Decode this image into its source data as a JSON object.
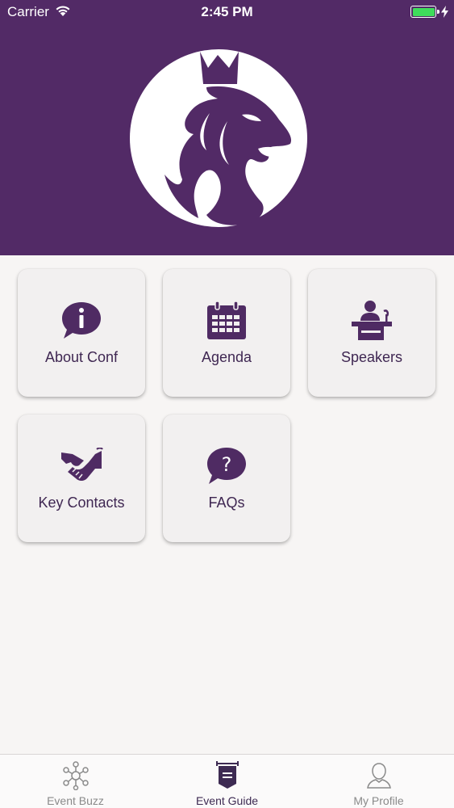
{
  "status_bar": {
    "carrier": "Carrier",
    "time": "2:45 PM"
  },
  "colors": {
    "brand_purple": "#522a66",
    "icon_purple": "#4f2b63",
    "battery_green": "#3fdc5b"
  },
  "header": {
    "logo_icon": "lion-head-logo-icon"
  },
  "tiles": [
    {
      "label": "About Conf",
      "icon": "info-speech-bubble-icon"
    },
    {
      "label": "Agenda",
      "icon": "calendar-icon"
    },
    {
      "label": "Speakers",
      "icon": "speaker-podium-icon"
    },
    {
      "label": "Key Contacts",
      "icon": "handshake-icon"
    },
    {
      "label": "FAQs",
      "icon": "question-speech-bubble-icon"
    }
  ],
  "tabbar": {
    "tabs": [
      {
        "label": "Event Buzz",
        "icon": "network-nodes-icon"
      },
      {
        "label": "Event Guide",
        "icon": "guide-banner-icon",
        "active": true
      },
      {
        "label": "My Profile",
        "icon": "user-profile-icon"
      }
    ]
  }
}
